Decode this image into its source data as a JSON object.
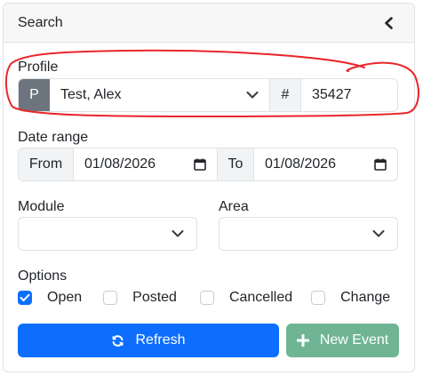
{
  "header": {
    "title": "Search"
  },
  "profile": {
    "label": "Profile",
    "prefix": "P",
    "selected": "Test, Alex",
    "id_prefix": "#",
    "id_value": "35427"
  },
  "date_range": {
    "label": "Date range",
    "from_label": "From",
    "from_value": "01/08/2026",
    "to_label": "To",
    "to_value": "01/08/2026"
  },
  "module": {
    "label": "Module",
    "value": ""
  },
  "area": {
    "label": "Area",
    "value": ""
  },
  "options": {
    "label": "Options",
    "items": [
      {
        "label": "Open",
        "checked": true
      },
      {
        "label": "Posted",
        "checked": false
      },
      {
        "label": "Cancelled",
        "checked": false
      },
      {
        "label": "Change",
        "checked": false
      }
    ]
  },
  "buttons": {
    "refresh": "Refresh",
    "new_event": "New Event"
  },
  "colors": {
    "primary": "#0d6efd",
    "success": "#6fb593",
    "annotation": "#e8262a",
    "addon_dark": "#6c757d"
  },
  "icons": [
    "chevron-left-icon",
    "chevron-down-icon",
    "calendar-icon",
    "check-icon",
    "refresh-icon",
    "plus-icon"
  ]
}
